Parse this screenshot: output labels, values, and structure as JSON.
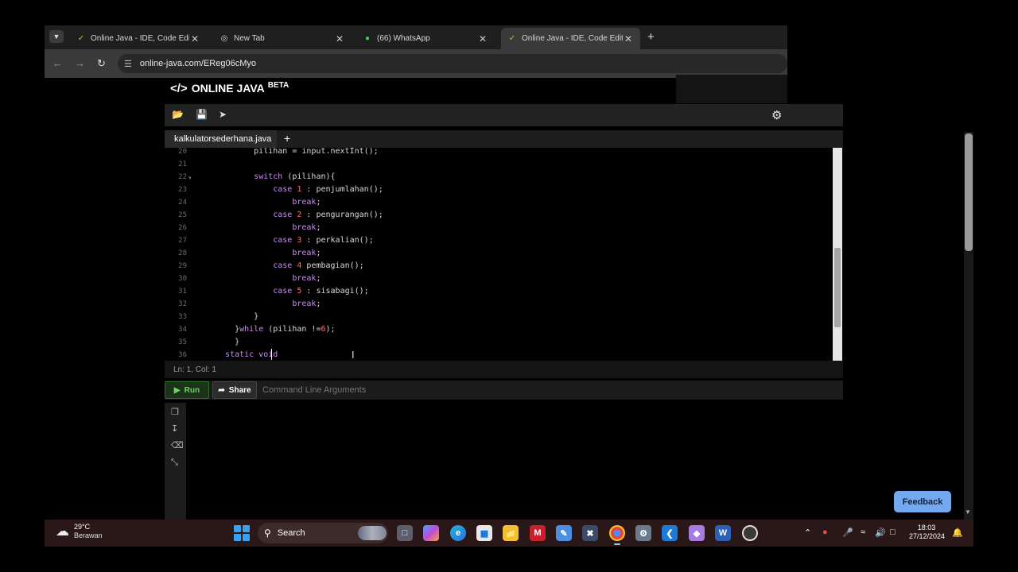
{
  "browser": {
    "tabs": [
      {
        "title": "Online Java - IDE, Code Editor,",
        "favicon": "online-java-icon",
        "active": false
      },
      {
        "title": "New Tab",
        "favicon": "chrome-icon",
        "active": false
      },
      {
        "title": "(66) WhatsApp",
        "favicon": "whatsapp-icon",
        "active": false
      },
      {
        "title": "Online Java - IDE, Code Editor, (",
        "favicon": "online-java-icon",
        "active": true
      }
    ],
    "url": "online-java.com/EReg06cMyo"
  },
  "site": {
    "brand": "ONLINE JAVA",
    "badge": "BETA"
  },
  "editor": {
    "file_tab": "kalkulatorsederhana.java",
    "status": "Ln: 1,  Col: 1",
    "lines": [
      {
        "n": "20",
        "html": "        pilihan = input.nextInt();"
      },
      {
        "n": "21",
        "html": ""
      },
      {
        "n": "22",
        "html": "        <span class='kw'>switch</span> (pilihan){",
        "fold": true
      },
      {
        "n": "23",
        "html": "            <span class='kw'>case</span> <span class='num'>1</span> : penjumlahan();"
      },
      {
        "n": "24",
        "html": "                <span class='kw'>break</span>;"
      },
      {
        "n": "25",
        "html": "            <span class='kw'>case</span> <span class='num'>2</span> : pengurangan();"
      },
      {
        "n": "26",
        "html": "                <span class='kw'>break</span>;"
      },
      {
        "n": "27",
        "html": "            <span class='kw'>case</span> <span class='num'>3</span> : perkalian();"
      },
      {
        "n": "28",
        "html": "                <span class='kw'>break</span>;"
      },
      {
        "n": "29",
        "html": "            <span class='kw'>case</span> <span class='num'>4</span> pembagian();"
      },
      {
        "n": "30",
        "html": "                <span class='kw'>break</span>;"
      },
      {
        "n": "31",
        "html": "            <span class='kw'>case</span> <span class='num'>5</span> : sisabagi();"
      },
      {
        "n": "32",
        "html": "                <span class='kw'>break</span>;"
      },
      {
        "n": "33",
        "html": "        }"
      },
      {
        "n": "34",
        "html": "    }<span class='kw'>while</span> (pilihan !=<span class='num'>6</span>);"
      },
      {
        "n": "35",
        "html": "    }"
      },
      {
        "n": "36",
        "html": "  <span class='kw'>static</span> <span class='kw'>void</span> "
      }
    ]
  },
  "controls": {
    "run_label": "Run",
    "share_label": "Share",
    "args_placeholder": "Command Line Arguments",
    "feedback_label": "Feedback"
  },
  "taskbar": {
    "temperature": "29°C",
    "weather": "Berawan",
    "search_label": "Search",
    "time": "18:03",
    "date": "27/12/2024",
    "apps": [
      "task-view-icon",
      "copilot-icon",
      "edge-icon",
      "store-icon",
      "file-explorer-icon",
      "mcafee-icon",
      "app-icon",
      "capcut-icon",
      "chrome-icon",
      "settings-icon",
      "vscode-icon",
      "shield-app-icon",
      "word-icon",
      "recorder-icon"
    ]
  }
}
